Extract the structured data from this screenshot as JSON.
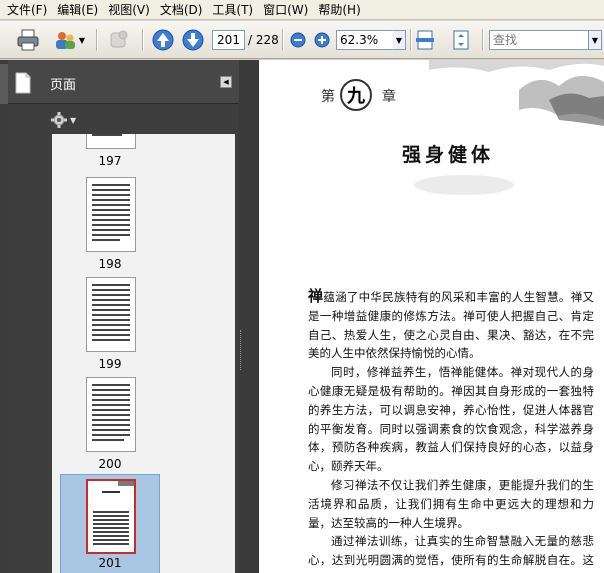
{
  "menu": [
    {
      "label": "文件(F)"
    },
    {
      "label": "编辑(E)"
    },
    {
      "label": "视图(V)"
    },
    {
      "label": "文档(D)"
    },
    {
      "label": "工具(T)"
    },
    {
      "label": "窗口(W)"
    },
    {
      "label": "帮助(H)"
    }
  ],
  "toolbar": {
    "page_current": "201",
    "page_total": "/ 228",
    "zoom": "62.3%",
    "search_placeholder": "查找"
  },
  "panel": {
    "title": "页面",
    "thumbnails": [
      {
        "label": "197"
      },
      {
        "label": "198"
      },
      {
        "label": "199"
      },
      {
        "label": "200"
      },
      {
        "label": "201"
      }
    ],
    "selected_page": "201"
  },
  "document": {
    "chapter_prefix": "第",
    "chapter_number": "九",
    "chapter_suffix": "章",
    "chapter_title": "强身健体",
    "paragraphs": [
      {
        "dropcap": "禅",
        "text": "蕴涵了中华民族特有的风采和丰富的人生智慧。禅又是一种增益健康的修炼方法。禅可使人把握自己、肯定自己、热爱人生，使之心灵自由、果决、豁达，在不完美的人生中依然保持愉悦的心情。"
      },
      {
        "text": "同时，修禅益养生，悟禅能健体。禅对现代人的身心健康无疑是极有帮助的。禅因其自身形成的一套独特的养生方法，可以调息安神，养心怡性，促进人体器官的平衡发育。同时以强调素食的饮食观念，科学滋养身体，预防各种疾病，教益人们保持良好的心态，以益身心，颐养天年。"
      },
      {
        "text": "修习禅法不仅让我们养生健康，更能提升我们的生活境界和品质，让我们拥有生命中更远大的理想和力量，达至较高的一种人生境界。"
      },
      {
        "text": "通过禅法训练，让真实的生命智慧融入无量的慈悲心，达到光明圆满的觉悟，使所有的生命解脱自在。这便是禅奉献给人类的贡献。"
      }
    ]
  },
  "colors": {
    "panel_bg": "#3e3e3e",
    "thumb_area_bg": "#f2f2f2",
    "selection": "#a9c6e2",
    "selected_thumb_border": "#cc2a2a"
  }
}
